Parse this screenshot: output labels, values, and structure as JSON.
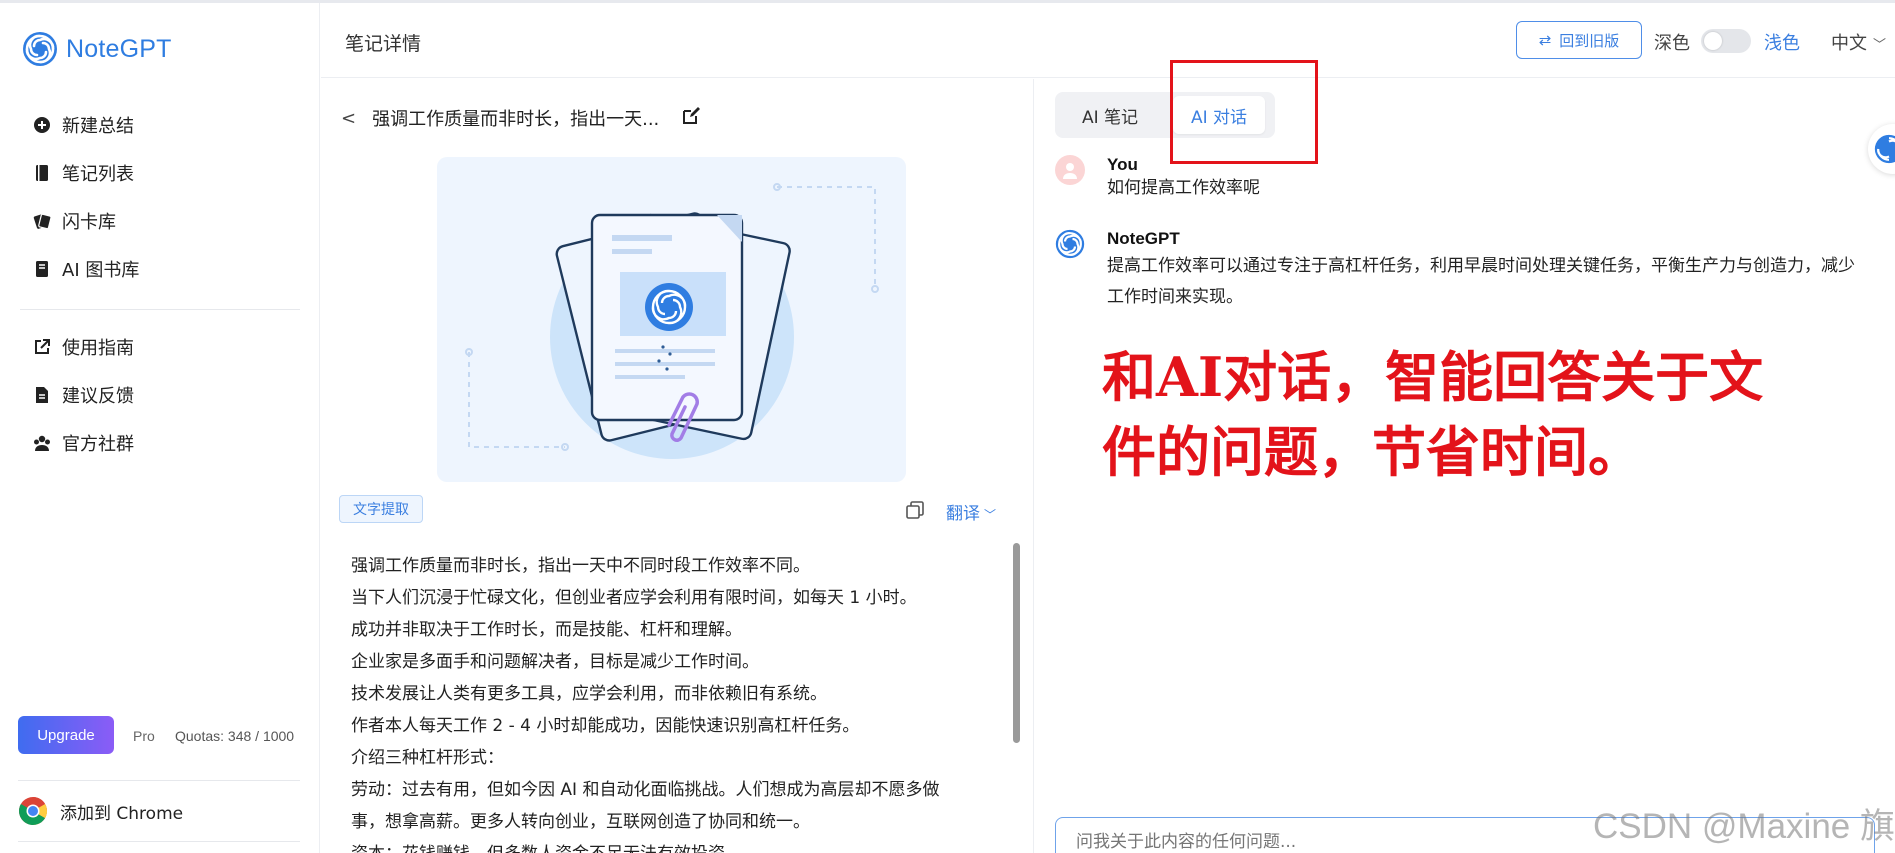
{
  "app": {
    "name": "NoteGPT"
  },
  "sidebar": {
    "items": [
      {
        "label": "新建总结"
      },
      {
        "label": "笔记列表"
      },
      {
        "label": "闪卡库"
      },
      {
        "label": "AI 图书库"
      }
    ],
    "items2": [
      {
        "label": "使用指南"
      },
      {
        "label": "建议反馈"
      },
      {
        "label": "官方社群"
      }
    ],
    "upgrade_label": "Upgrade",
    "pro_label": "Pro",
    "quota_label": "Quotas: 348 / 1000",
    "chrome_label": "添加到 Chrome"
  },
  "header": {
    "title": "笔记详情",
    "old_version_label": "回到旧版",
    "dark_label": "深色",
    "light_label": "浅色",
    "language": "中文"
  },
  "document": {
    "title": "强调工作质量而非时长，指出一天...",
    "extract_tag": "文字提取",
    "translate_label": "翻译",
    "lines": [
      "强调工作质量而非时长，指出一天中不同时段工作效率不同。",
      "当下人们沉浸于忙碌文化，但创业者应学会利用有限时间，如每天 1 小时。",
      "成功并非取决于工作时长，而是技能、杠杆和理解。",
      "企业家是多面手和问题解决者，目标是减少工作时间。",
      "技术发展让人类有更多工具，应学会利用，而非依赖旧有系统。",
      "作者本人每天工作 2 - 4 小时却能成功，因能快速识别高杠杆任务。",
      "介绍三种杠杆形式：",
      "劳动：过去有用，但如今因 AI 和自动化面临挑战。人们想成为高层却不愿多做",
      "事，想拿高薪。更多人转向创业，互联网创造了协同和统一。",
      "资本：花钱赚钱，但多数人资金不足无法有效投资。"
    ]
  },
  "chat": {
    "tabs": [
      {
        "label": "AI 笔记"
      },
      {
        "label": "AI 对话"
      }
    ],
    "messages": [
      {
        "name": "You",
        "text": "如何提高工作效率呢"
      },
      {
        "name": "NoteGPT",
        "line1": "提高工作效率可以通过专注于高杠杆任务，利用早晨时间处理关键任务，平衡生产力与创造力，减少",
        "line2": "工作时间来实现。"
      }
    ],
    "input_placeholder": "问我关于此内容的任何问题..."
  },
  "annotation": {
    "line1": "和AI对话，智能回答关于文",
    "line2": "件的问题，节省时间。"
  },
  "watermark": "CSDN @Maxine 旗",
  "colors": {
    "brand": "#2f7de1",
    "accent_red": "#e3131a",
    "upgrade_gradient": [
      "#3f6cf0",
      "#8b5cf6"
    ]
  },
  "icons": {
    "sidebar": [
      "plus-circle-icon",
      "notebook-icon",
      "flashcard-icon",
      "book-icon",
      "external-link-icon",
      "document-icon",
      "community-icon"
    ],
    "header": [
      "swap-icon",
      "chevron-down-icon"
    ],
    "document": [
      "chevron-left-icon",
      "edit-icon",
      "copy-icon"
    ]
  }
}
